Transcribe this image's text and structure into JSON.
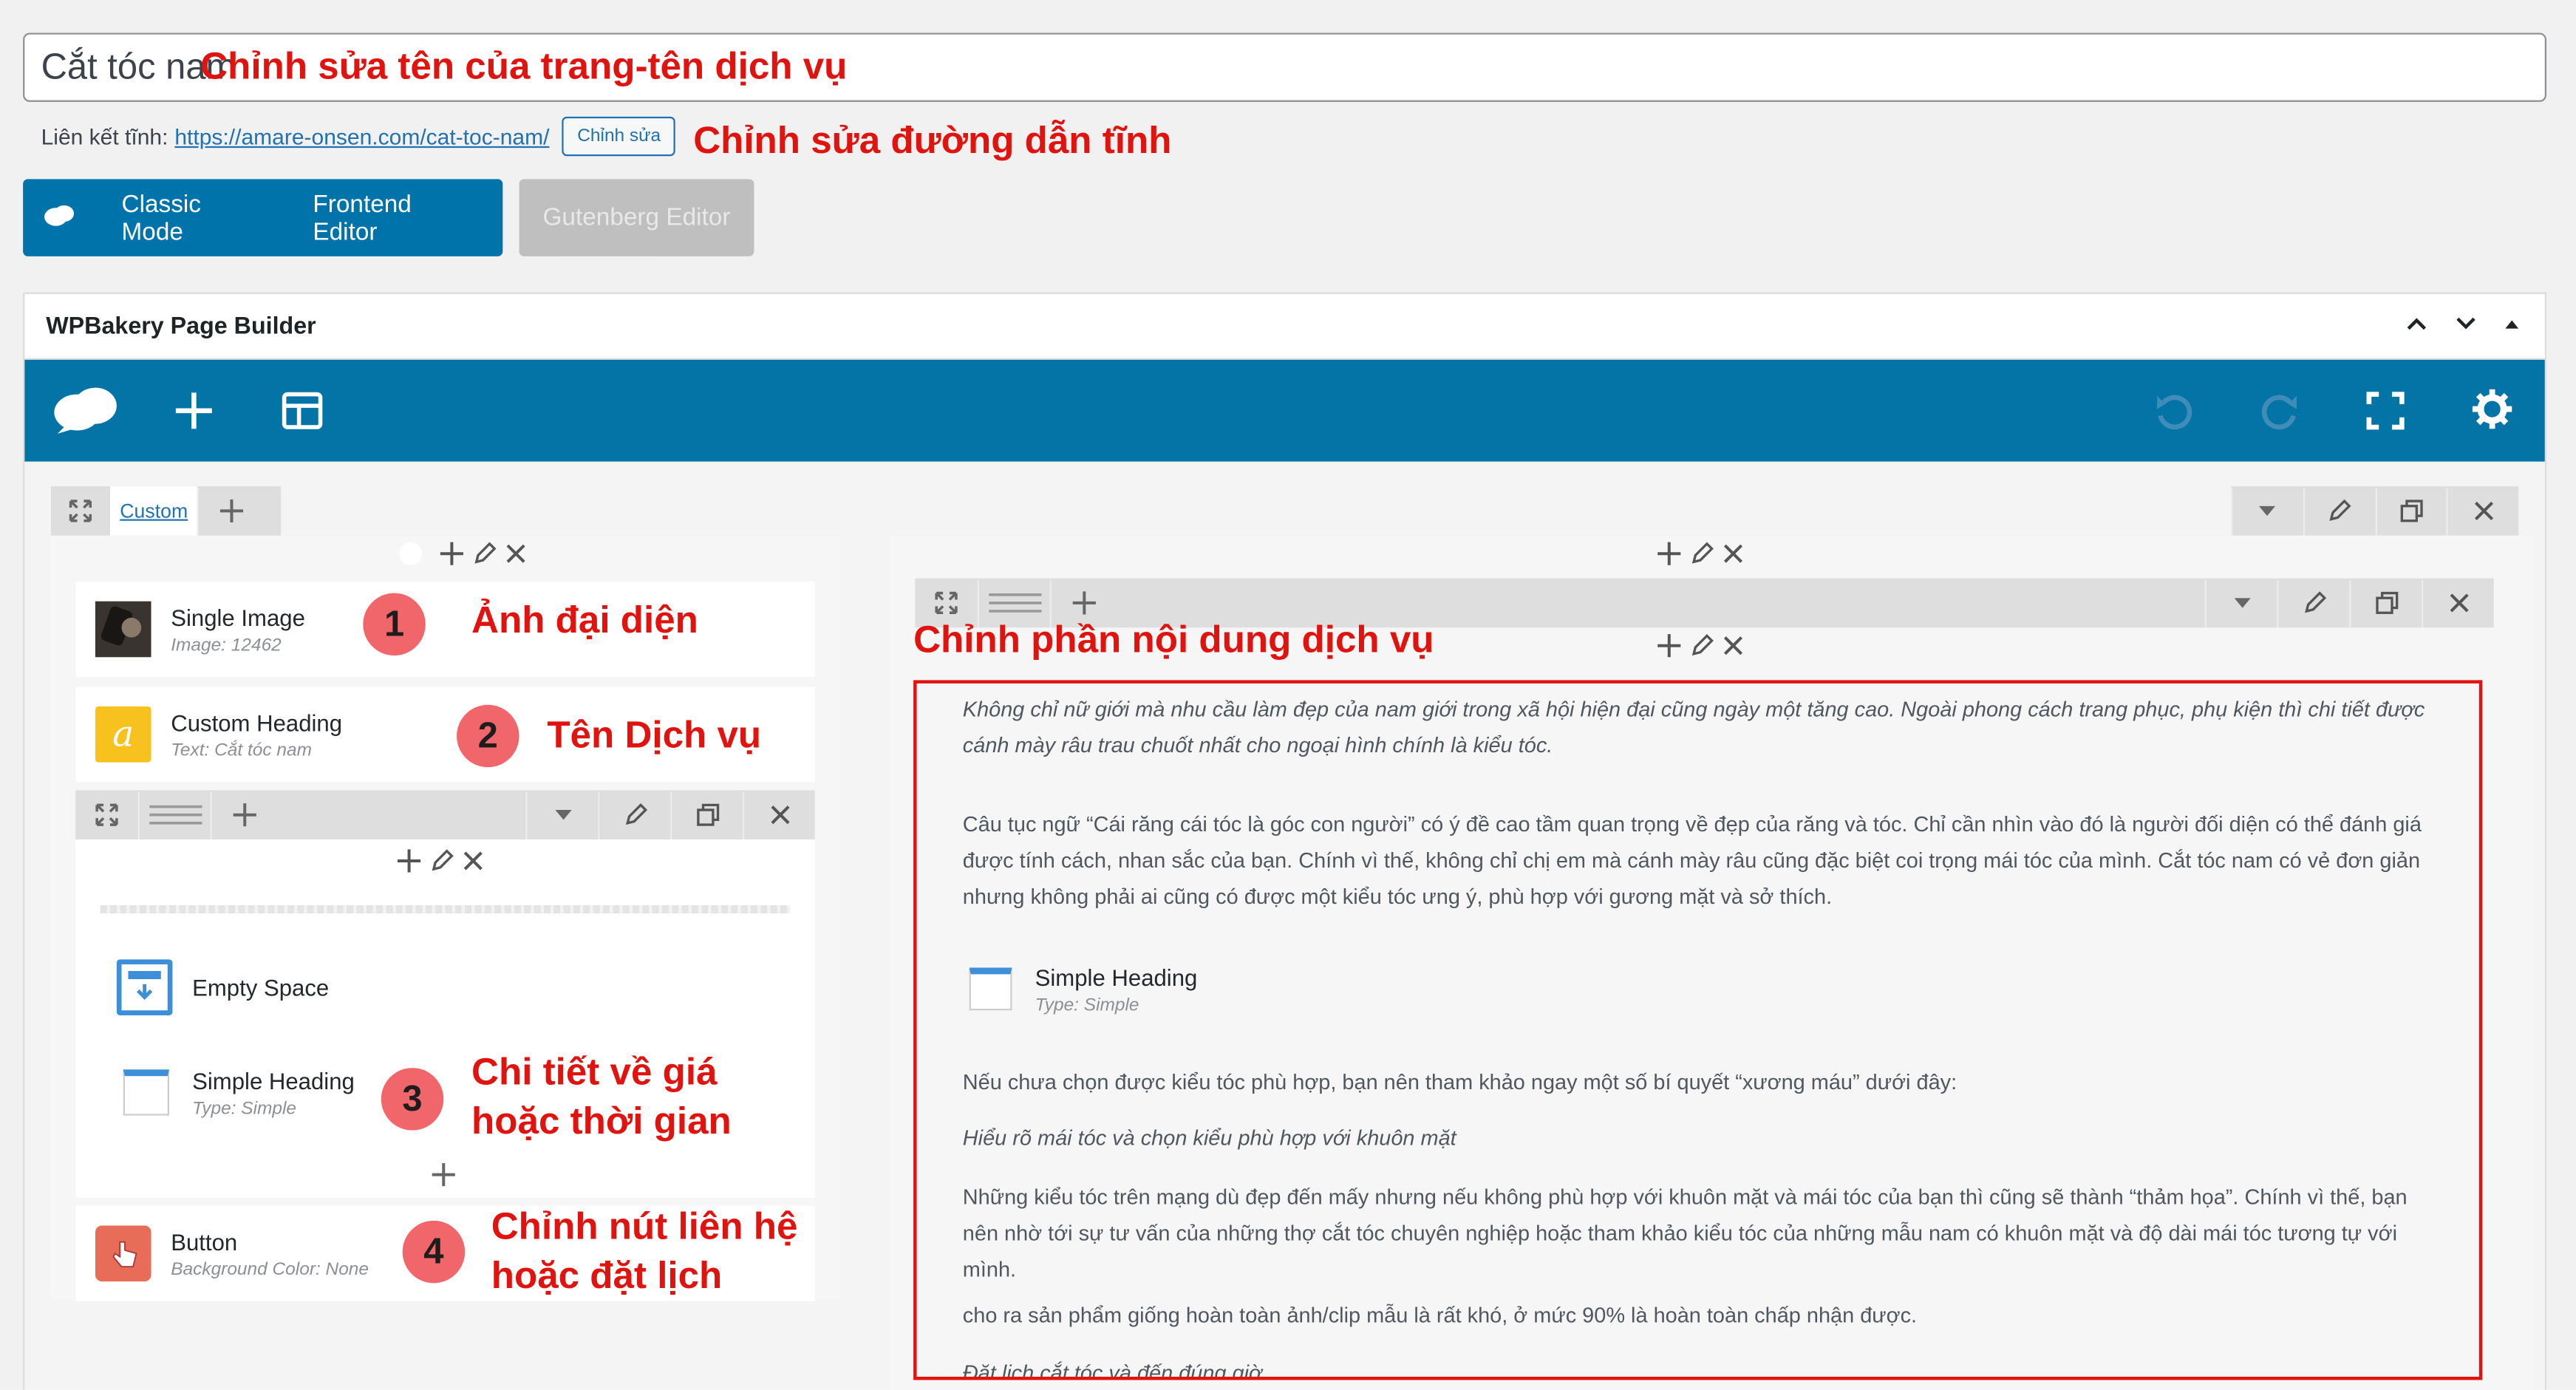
{
  "page_title_value": "Cắt tóc nam",
  "permalink": {
    "label": "Liên kết tĩnh:",
    "url": "https://amare-onsen.com/cat-toc-nam/",
    "edit_button": "Chỉnh sửa"
  },
  "editor_modes": {
    "classic": "Classic Mode",
    "frontend": "Frontend Editor",
    "gutenberg": "Gutenberg Editor"
  },
  "wpbakery": {
    "title": "WPBakery Page Builder",
    "left_column": {
      "tab_label": "Custom",
      "elements": [
        {
          "name": "Single Image",
          "sub": "Image: 12462"
        },
        {
          "name": "Custom Heading",
          "sub": "Text: Cắt tóc nam"
        }
      ],
      "inner_elements": [
        {
          "name": "Empty Space",
          "sub": ""
        },
        {
          "name": "Simple Heading",
          "sub": "Type: Simple"
        }
      ],
      "button_element": {
        "name": "Button",
        "sub": "Background Color: None"
      }
    },
    "right_column": {
      "paragraphs": [
        "Không chỉ nữ giới mà nhu cầu làm đẹp của nam giới trong xã hội hiện đại cũng ngày một tăng cao. Ngoài phong cách trang phục, phụ kiện thì chi tiết được cánh mày râu trau chuốt nhất cho ngoại hình chính là kiểu tóc.",
        "Câu tục ngữ “Cái răng cái tóc là góc con người” có ý đề cao tầm quan trọng về đẹp của răng và tóc. Chỉ cần nhìn vào đó là người đối diện có thể đánh giá được tính cách, nhan sắc của bạn. Chính vì thế, không chỉ chị em mà cánh mày râu cũng đặc biệt coi trọng mái tóc của mình. Cắt tóc nam có vẻ đơn giản nhưng không phải ai cũng có được một kiểu tóc ưng ý, phù hợp với gương mặt và sở thích."
      ],
      "simple_heading": {
        "name": "Simple Heading",
        "sub": "Type: Simple"
      },
      "para3": "Nếu chưa chọn được kiểu tóc phù hợp, bạn nên tham khảo ngay một số bí quyết “xương máu” dưới đây:",
      "para4": "Hiểu rõ mái tóc và chọn kiểu phù hợp với khuôn mặt",
      "para5": "Những kiểu tóc trên mạng dù đẹp đến mấy nhưng nếu không phù hợp với khuôn mặt và mái tóc của bạn thì cũng sẽ thành “thảm họa”. Chính vì thế, bạn nên nhờ tới sự tư vấn của những thợ cắt tóc chuyên nghiệp hoặc tham khảo kiểu tóc của những mẫu nam có khuôn mặt và độ dài mái tóc tương tự với mình.",
      "para6": "cho ra sản phẩm giống hoàn toàn ảnh/clip mẫu là rất khó, ở mức 90% là hoàn toàn chấp nhận được.",
      "para7": "Đặt lịch cắt tóc và đến đúng giờ"
    }
  },
  "annotations": {
    "title": "Chỉnh sửa tên của trang-tên dịch vụ",
    "slug": "Chỉnh sửa đường dẫn tĩnh",
    "content": "Chỉnh phần nội dung dịch vụ",
    "a1": "Ảnh đại diện",
    "a2": "Tên Dịch vụ",
    "a3_line1": "Chi tiết về giá",
    "a3_line2": "hoặc thời gian",
    "a4_line1": "Chỉnh nút liên hệ",
    "a4_line2": "hoặc đặt lịch",
    "n1": "1",
    "n2": "2",
    "n3": "3",
    "n4": "4"
  },
  "colors": {
    "wpb_blue": "#0474a6",
    "annotation_red": "#e1130f",
    "badge_red": "#f1666a"
  }
}
